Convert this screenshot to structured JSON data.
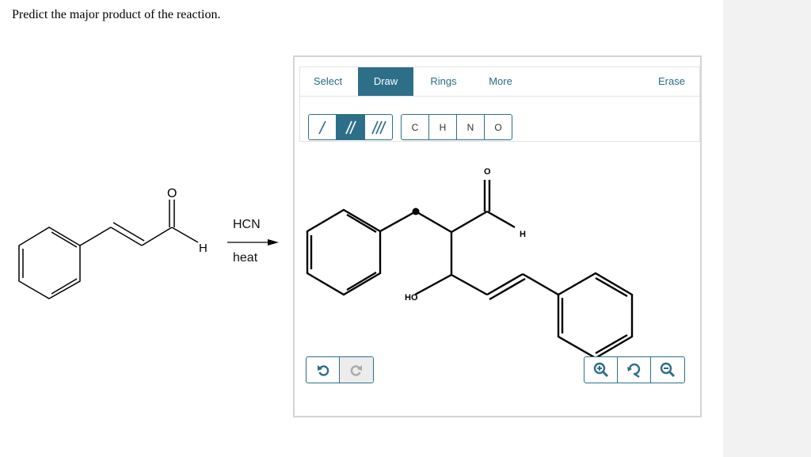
{
  "question": {
    "text": "Predict the major product of the reaction."
  },
  "reaction": {
    "reactant_labels": {
      "oxygen": "O",
      "hydrogen": "H"
    },
    "reagent_top": "HCN",
    "reagent_bottom": "heat"
  },
  "editor": {
    "tabs": [
      {
        "label": "Select",
        "active": false
      },
      {
        "label": "Draw",
        "active": true
      },
      {
        "label": "Rings",
        "active": false
      },
      {
        "label": "More",
        "active": false
      }
    ],
    "erase_label": "Erase",
    "bond_buttons": [
      {
        "icon": "single-bond-icon",
        "active": false
      },
      {
        "icon": "double-bond-icon",
        "active": true
      },
      {
        "icon": "triple-bond-icon",
        "active": false
      }
    ],
    "atom_buttons": [
      "C",
      "H",
      "N",
      "O"
    ],
    "structure_labels": {
      "oxygen": "O",
      "hydrogen": "H",
      "hydroxyl": "HO"
    },
    "undo_icon": "undo-icon",
    "redo_icon": "redo-icon",
    "zoom_buttons": [
      "zoom-in-icon",
      "reset-zoom-icon",
      "zoom-out-icon"
    ],
    "colors": {
      "accent": "#2d6f88",
      "border": "#d4d4d4"
    }
  }
}
